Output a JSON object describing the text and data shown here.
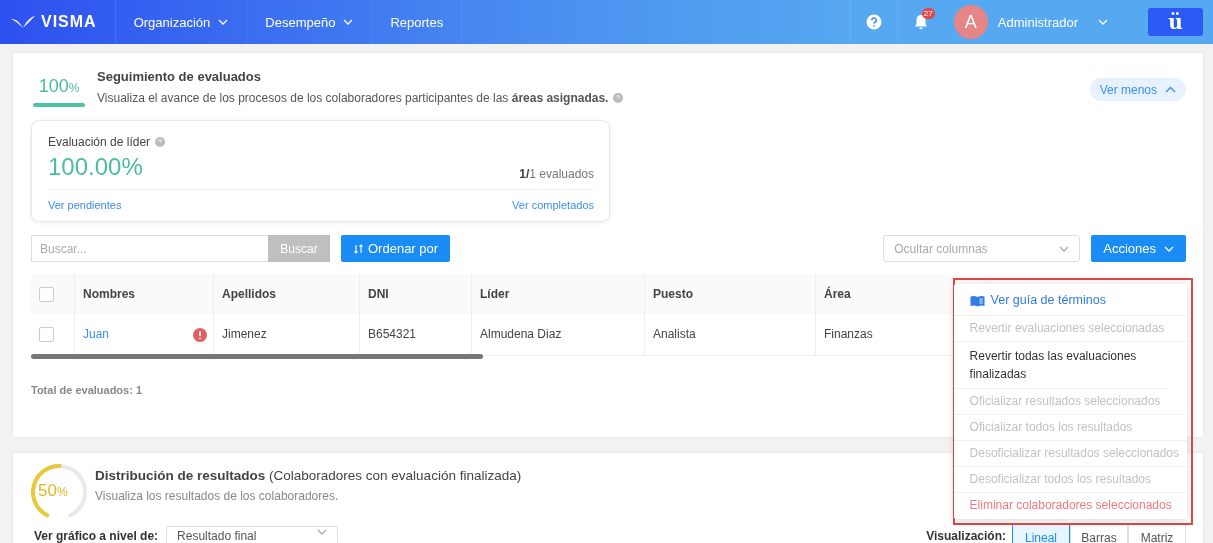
{
  "navbar": {
    "logo": "VISMA",
    "menu": [
      {
        "label": "Organización",
        "dropdown": true
      },
      {
        "label": "Desempeño",
        "dropdown": true
      },
      {
        "label": "Reportes",
        "dropdown": false
      }
    ],
    "notifications": "27",
    "user": {
      "initial": "A",
      "name": "Administrador"
    },
    "app_button": "ü"
  },
  "tracking": {
    "percent": "100",
    "percent_sign": "%",
    "level": 1,
    "title": "Seguimiento de evaluados",
    "description": "Visualiza el avance de los procesos de los colaboradores participantes de las **áreas asignadas.**",
    "toggle": "Ver menos"
  },
  "leader_card": {
    "title": "Evaluación de líder",
    "value": "100.00%",
    "count": "**1/**1 evaluados",
    "link_left": "Ver pendientes",
    "link_right": "Ver completados"
  },
  "toolbar": {
    "search_placeholder": "Buscar...",
    "search_button": "Buscar",
    "sort_button": "Ordenar por",
    "columns_placeholder": "Ocultar columnas",
    "actions_button": "Acciones"
  },
  "table": {
    "all_selected": false,
    "columns": [
      "Nombres",
      "Apellidos",
      "DNI",
      "Líder",
      "Puesto",
      "Área"
    ],
    "rows": [
      {
        "selected": false,
        "warning": true,
        "cells": [
          "Juan",
          "Jimenez",
          "B654321",
          "Almudena Diaz",
          "Analista",
          "Finanzas"
        ]
      }
    ]
  },
  "total": "Total de evaluados: 1",
  "actions_menu": {
    "highlighted": true,
    "items": [
      {
        "kind": "guide",
        "label": "Ver guía de términos",
        "disabled": false
      },
      {
        "kind": "item",
        "label": "Revertir evaluaciones seleccionadas",
        "disabled": true
      },
      {
        "kind": "item",
        "label": "Revertir todas las evaluaciones finalizadas",
        "disabled": false
      },
      {
        "kind": "item",
        "label": "Oficializar resultados seleccionados",
        "disabled": true
      },
      {
        "kind": "item",
        "label": "Oficializar todos los resultados",
        "disabled": true
      },
      {
        "kind": "item",
        "label": "Desoficializar resultados seleccionados",
        "disabled": true
      },
      {
        "kind": "item",
        "label": "Desoficializar todos los resultados",
        "disabled": true
      },
      {
        "kind": "danger",
        "label": "Eliminar colaboradores seleccionados",
        "disabled": false
      }
    ]
  },
  "distribution": {
    "percent": "50",
    "percent_sign": "%",
    "level": 0.5,
    "title": "**Distribución de resultados** (Colaboradores con evaluación finalizada)",
    "subtitle": "Visualiza los resultados de los colaboradores.",
    "level_label": "Ver gráfico a nivel de:",
    "level_select": "Resultado final",
    "view_label": "Visualización:",
    "views": [
      {
        "label": "Lineal",
        "selected": true
      },
      {
        "label": "Barras",
        "selected": false
      },
      {
        "label": "Matriz",
        "selected": false
      }
    ]
  }
}
